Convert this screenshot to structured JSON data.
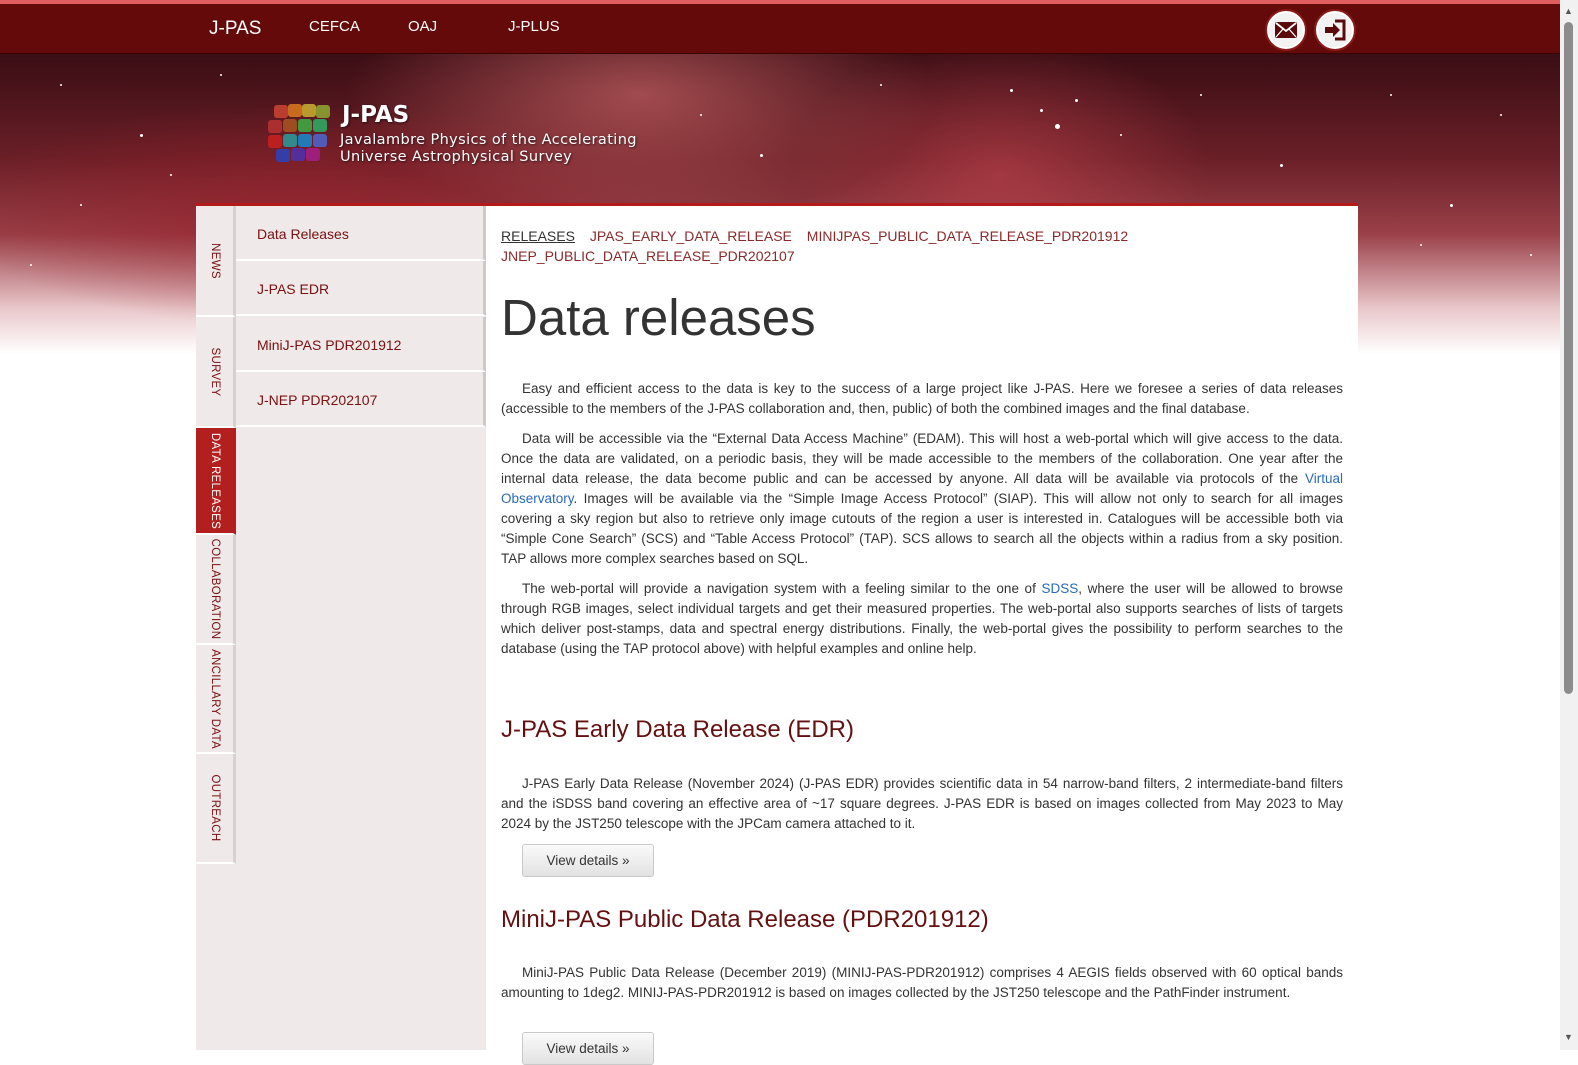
{
  "topnav": {
    "brand": "J-PAS",
    "links": [
      "CEFCA",
      "OAJ",
      "J-PLUS"
    ],
    "icons": [
      "mail-icon",
      "login-icon"
    ]
  },
  "header": {
    "title": "J-PAS",
    "subtitle_line1": "Javalambre Physics of the Accelerating",
    "subtitle_line2": "Universe Astrophysical Survey"
  },
  "vertical_tabs": [
    "NEWS",
    "SURVEY",
    "DATA RELEASES",
    "COLLABORATION",
    "ANCILLARY DATA",
    "OUTREACH"
  ],
  "active_tab": "DATA RELEASES",
  "side_menu": [
    "Data Releases",
    "J-PAS EDR",
    "MiniJ-PAS PDR201912",
    "J-NEP PDR202107"
  ],
  "breadcrumb_tabs": [
    "RELEASES",
    "JPAS_EARLY_DATA_RELEASE",
    "MINIJPAS_PUBLIC_DATA_RELEASE_PDR201912",
    "JNEP_PUBLIC_DATA_RELEASE_PDR202107"
  ],
  "page_title": "Data releases",
  "intro": {
    "p1": "Easy and efficient access to the data is key to the success of a large project like J-PAS. Here we foresee a series of data releases (accessible to the members of the J-PAS collaboration and, then, public) of both the combined images and the final database.",
    "p2_before": "Data will be accessible via the “External Data Access Machine” (EDAM). This will host a web-portal which will give access to the data. Once the data are validated, on a periodic basis, they will be made accessible to the members of the collaboration. One year after the internal data release, the data become public and can be accessed by anyone. All data will be available via protocols of the ",
    "p2_link": "Virtual Observatory",
    "p2_after": ". Images will be available via the “Simple Image Access Protocol” (SIAP). This will allow not only to search for all images covering a sky region but also to retrieve only image cutouts of the region a user is interested in. Catalogues will be accessible both via “Simple Cone Search” (SCS) and “Table Access Protocol” (TAP). SCS allows to search all the objects within a radius from a sky position. TAP allows more complex searches based on SQL.",
    "p3_before": "The web-portal will provide a navigation system with a feeling similar to the one of ",
    "p3_link": "SDSS",
    "p3_after": ", where the user will be allowed to browse through RGB images, select individual targets and get their measured properties. The web-portal also supports searches of lists of targets which deliver post-stamps, data and spectral energy distributions. Finally, the web-portal gives the possibility to perform searches to the database (using the TAP protocol above) with helpful examples and online help."
  },
  "sections": [
    {
      "title": "J-PAS Early Data Release (EDR)",
      "text": "J-PAS Early Data Release (November 2024) (J-PAS EDR) provides scientific data in 54 narrow-band filters, 2 intermediate-band filters and the iSDSS band covering an effective area of ~17 square degrees. J-PAS EDR is based on images collected from May 2023 to May 2024 by the JST250 telescope with the JPCam camera attached to it.",
      "button": "View details »"
    },
    {
      "title": "MiniJ-PAS Public Data Release (PDR201912)",
      "text": "MiniJ-PAS Public Data Release (December 2019) (MINIJ-PAS-PDR201912) comprises 4 AEGIS fields observed with 60 optical bands amounting to 1deg2. MINIJ-PAS-PDR201912 is based on images collected by the JST250 telescope and the PathFinder instrument.",
      "button": "View details »"
    }
  ],
  "colors": {
    "topbar": "#650a0a",
    "accent": "#b31e1e",
    "link": "#2a6ab8",
    "heading": "#651010"
  }
}
